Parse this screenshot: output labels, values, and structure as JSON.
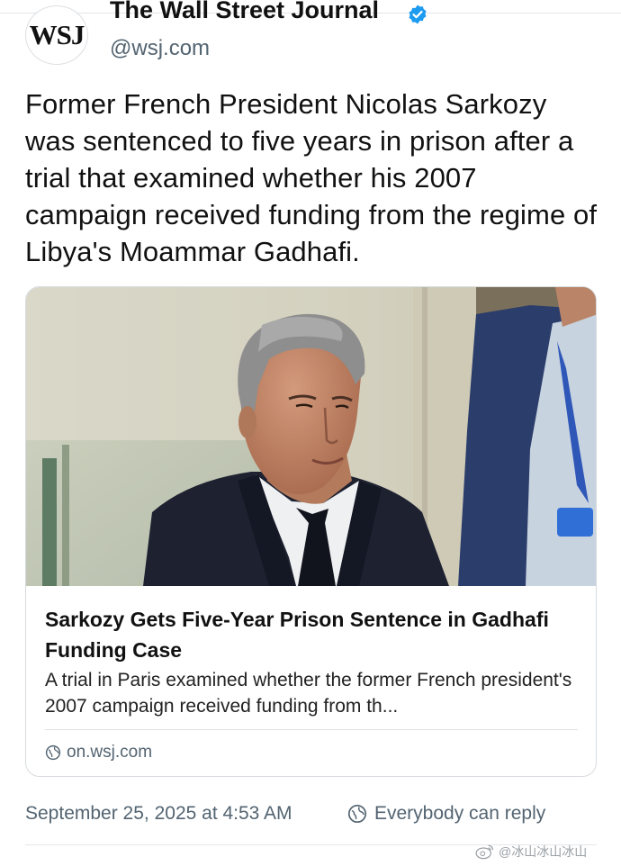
{
  "account": {
    "avatar_text": "WSJ",
    "display_name": "The Wall Street Journal",
    "handle": "@wsj.com",
    "verified_icon": "verified-badge-icon",
    "verified_color": "#1d9bf0"
  },
  "tweet": {
    "text": "Former French President Nicolas Sarkozy was sentenced to five years in prison after a trial that examined whether his 2007 campaign received funding from the regime of Libya's Moammar Gadhafi."
  },
  "link_card": {
    "image_icon": "news-photo",
    "title": "Sarkozy Gets Five-Year Prison Sentence in Gadhafi Funding Case",
    "description": "A trial in Paris examined whether the former French president's 2007 campaign received funding from th...",
    "domain": "on.wsj.com",
    "domain_icon": "globe-icon"
  },
  "footer": {
    "timestamp": "September 25, 2025 at 4:53 AM",
    "reply_setting": "Everybody can reply",
    "reply_icon": "reply-globe-icon"
  },
  "watermark": {
    "text": "@冰山冰山冰山",
    "icon": "weibo-icon"
  },
  "colors": {
    "text": "#111111",
    "secondary": "#536471",
    "border": "#d7dbdf"
  }
}
